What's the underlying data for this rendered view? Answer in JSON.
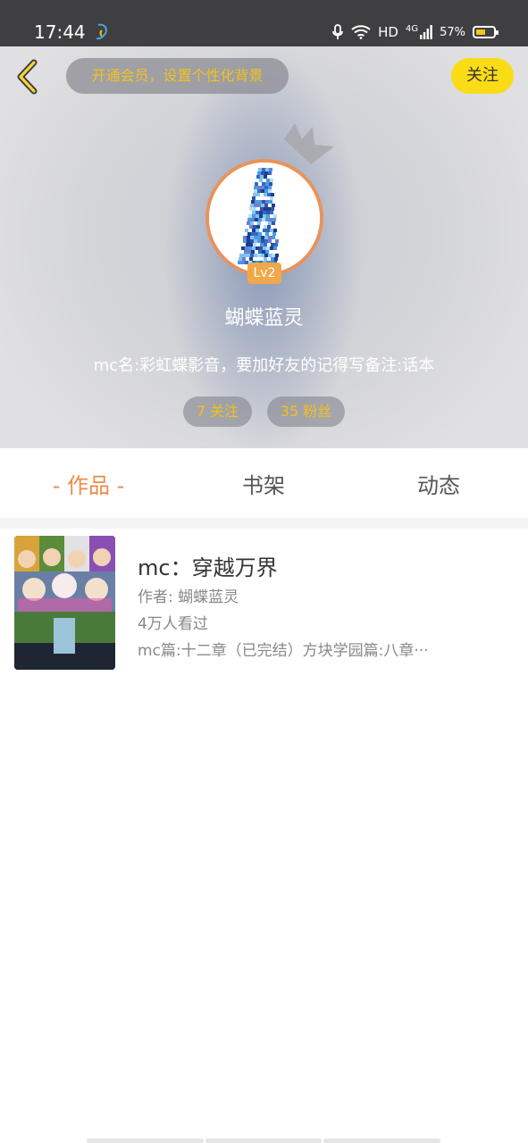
{
  "status_bar": {
    "time": "17:44",
    "network": "HD",
    "signal": "4G",
    "battery": "57%",
    "battery_level": 0.57
  },
  "header": {
    "vip_banner": "开通会员，设置个性化背景",
    "follow_label": "关注",
    "level": "Lv2",
    "username": "蝴蝶蓝灵",
    "bio": "mc名:彩虹蝶影音，要加好友的记得写备注:话本",
    "following": "7 关注",
    "followers": "35 粉丝",
    "colors": {
      "accent_yellow": "#fadc16",
      "avatar_border": "#e8935b"
    }
  },
  "tabs": [
    {
      "label": "- 作品 -",
      "active": true
    },
    {
      "label": "书架",
      "active": false
    },
    {
      "label": "动态",
      "active": false
    }
  ],
  "works": [
    {
      "title": "mc：穿越万界",
      "author": "作者: 蝴蝶蓝灵",
      "views": "4万人看过",
      "summary": "mc篇:十二章（已完结）方块学园篇:八章···"
    }
  ],
  "icons": [
    "back-icon",
    "crown-icon",
    "microphone-icon",
    "wifi-icon",
    "signal-icon",
    "battery-icon"
  ],
  "colors": {
    "tab_active": "#ef8a4a",
    "status_bar_bg": "#3f3f41"
  }
}
